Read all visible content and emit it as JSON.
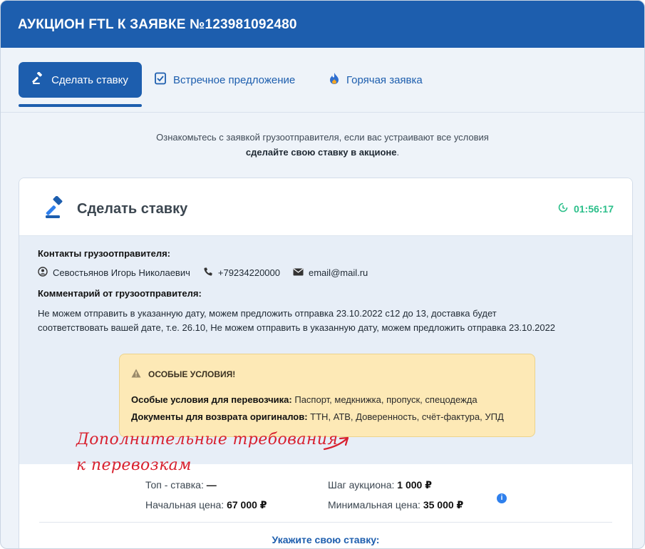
{
  "header": {
    "title": "АУКЦИОН FTL К ЗАЯВКЕ №123981092480"
  },
  "tabs": [
    {
      "label": "Сделать ставку",
      "icon": "gavel-icon",
      "active": true
    },
    {
      "label": "Встречное предложение",
      "icon": "counter-offer-icon",
      "active": false
    },
    {
      "label": "Горячая заявка",
      "icon": "fire-icon",
      "active": false
    }
  ],
  "intro": {
    "line1": "Ознакомьтесь с заявкой грузоотправителя, если вас устраивают все условия",
    "line2_bold": "сделайте свою ставку в акционе",
    "line2_end": "."
  },
  "card": {
    "title": "Сделать ставку",
    "timer": "01:56:17",
    "contacts_label": "Контакты грузоотправителя:",
    "contact_name": "Севостьянов Игорь Николаевич",
    "contact_phone": "+79234220000",
    "contact_email": "email@mail.ru",
    "comment_label": "Комментарий от грузоотправителя:",
    "comment_line1": "Не можем отправить в указанную дату, можем предложить отправка 23.10.2022 с12 до 13, доставка будет",
    "comment_line2": "соответствовать вашей дате, т.е. 26.10, Не можем отправить в указанную дату, можем предложить отправка 23.10.2022",
    "special": {
      "title": "ОСОБЫЕ УСЛОВИЯ!",
      "carrier_label": "Особые условия для перевозчика:",
      "carrier_value": "Паспорт, медкнижка, пропуск, спецодежда",
      "docs_label": "Документы для возврата оригиналов:",
      "docs_value": "ТТН, АТВ, Доверенность, счёт-фактура, УПД"
    },
    "handwritten_line1": "Дополнительные требования",
    "handwritten_line2": "к перевозкам",
    "top_bid_label": "Топ - ставка:",
    "top_bid_value": "—",
    "auction_step_label": "Шаг аукциона:",
    "auction_step_value": "1 000 ₽",
    "start_price_label": "Начальная цена:",
    "start_price_value": "67 000 ₽",
    "min_price_label": "Минимальная цена:",
    "min_price_value": "35 000 ₽",
    "info_icon": "i",
    "bid_prompt": "Укажите свою ставку:"
  },
  "colors": {
    "brand": "#1d5eae",
    "timer": "#2bbf8a",
    "warning_bg": "#fde9b6",
    "handwriting": "#d8202e"
  }
}
